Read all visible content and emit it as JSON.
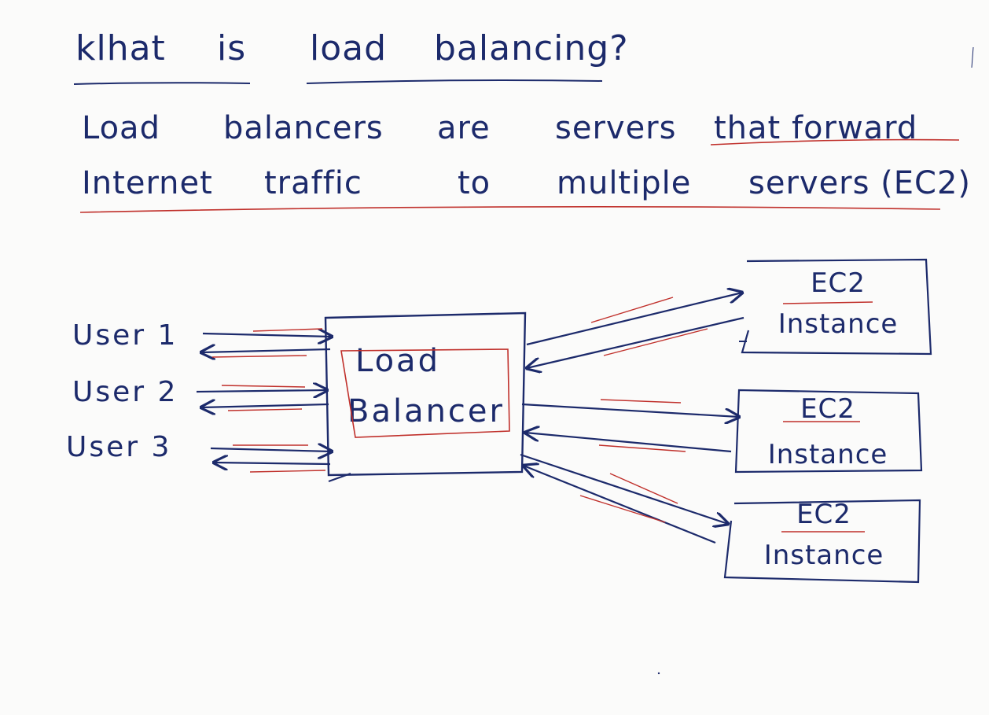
{
  "question": {
    "words": [
      "klhat",
      "is",
      "load",
      "balancing?"
    ]
  },
  "definition": {
    "line1": [
      "Load",
      "balancers",
      "are",
      "servers",
      "that forward"
    ],
    "line2": [
      "Internet",
      "traffic",
      "to",
      "multiple",
      "servers (EC2)"
    ]
  },
  "diagram": {
    "users": [
      "User 1",
      "User 2",
      "User 3"
    ],
    "load_balancer": [
      "Load",
      "Balancer"
    ],
    "instances": [
      {
        "name": "EC2",
        "type": "Instance"
      },
      {
        "name": "EC2",
        "type": "Instance"
      },
      {
        "name": "EC2",
        "type": "Instance"
      }
    ]
  },
  "colors": {
    "ink": "#1c2a6b",
    "accent": "#c0302b",
    "paper": "#fbfbfa"
  }
}
